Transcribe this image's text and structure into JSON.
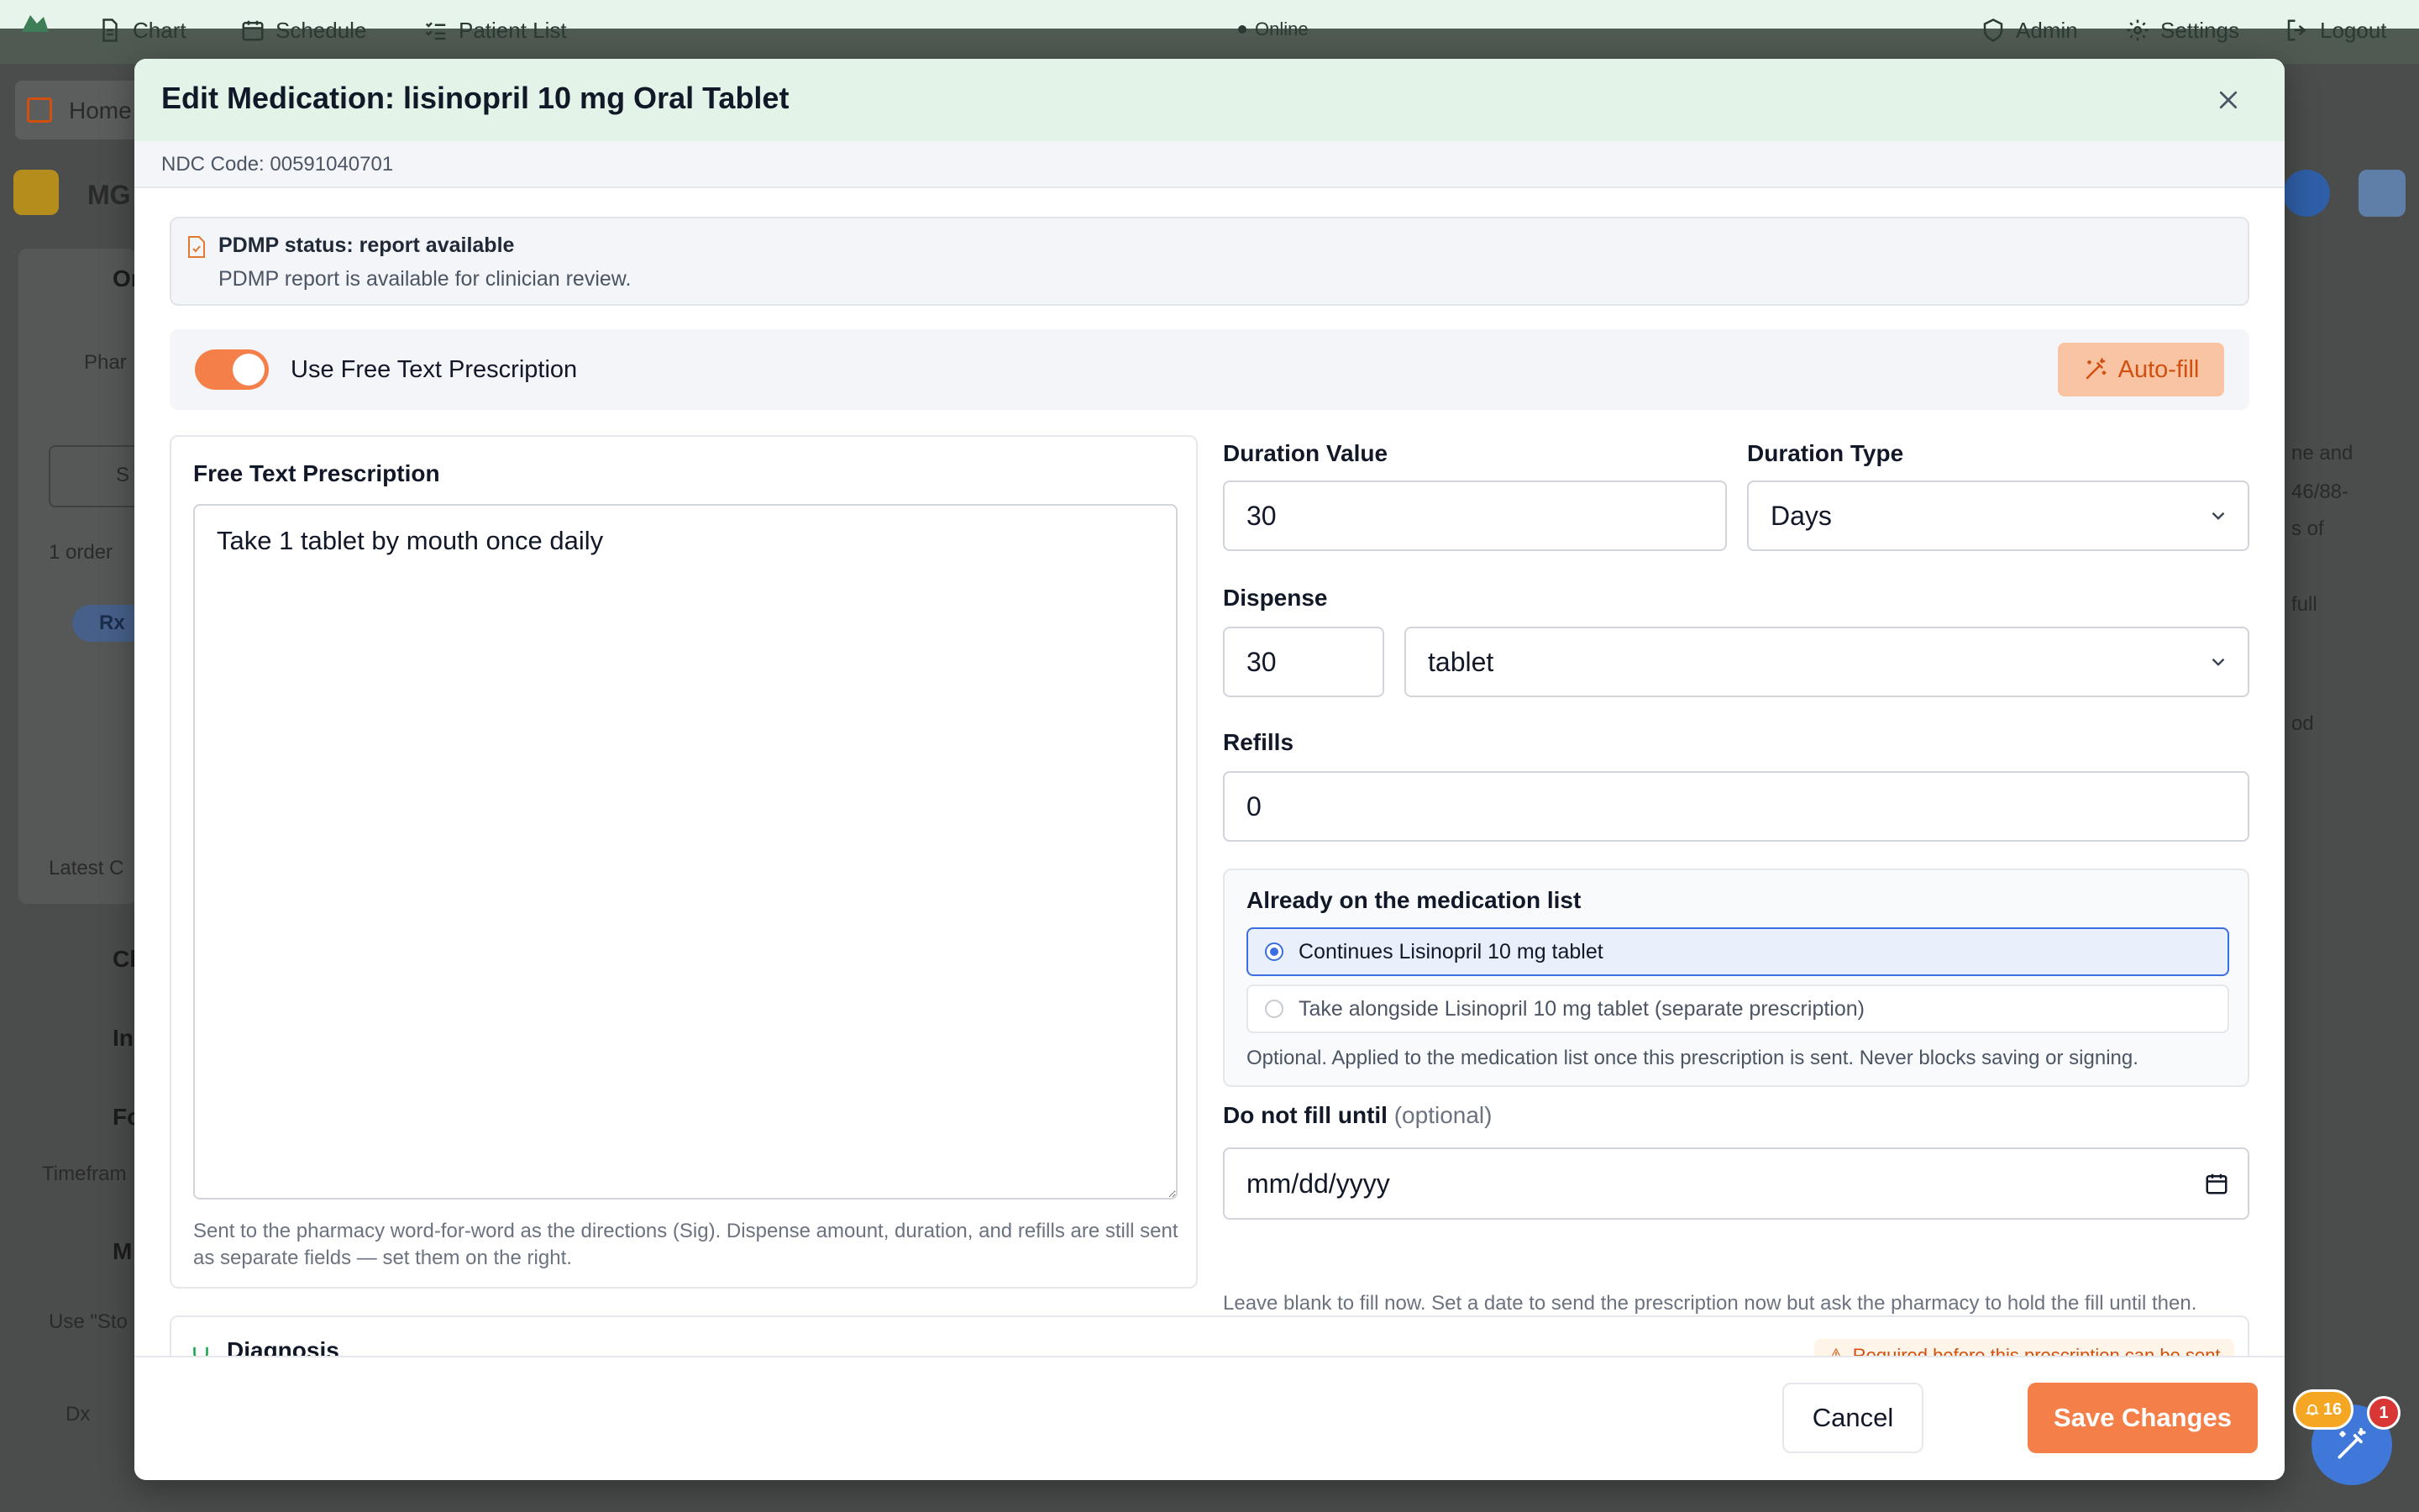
{
  "app_nav": {
    "chart": "Chart",
    "schedule": "Schedule",
    "patient_list": "Patient List",
    "status": "Online",
    "admin": "Admin",
    "settings": "Settings",
    "logout": "Logout"
  },
  "background": {
    "home": "Home",
    "patient_initials": "MG",
    "orders_section": "Or",
    "pharmacy": "Phar",
    "search_placeholder": "S",
    "order_count": "1 order",
    "rx_badge": "Rx",
    "latest": "Latest C",
    "section_cl": "Cl",
    "section_in": "In",
    "section_fo": "Fo",
    "timeframe": "Timefram",
    "section_m": "M",
    "use_store": "Use \"Sto",
    "dx_label": "Dx",
    "right_fragments": [
      "ne and",
      "46/88-",
      "s of",
      "full",
      "od"
    ]
  },
  "modal": {
    "title": "Edit Medication: lisinopril 10 mg Oral Tablet",
    "ndc": "NDC Code: 00591040701",
    "pdmp_title": "PDMP status: report available",
    "pdmp_text": "PDMP report is available for clinician review.",
    "free_text_toggle_label": "Use Free Text Prescription",
    "free_text_enabled": true,
    "autofill_label": "Auto-fill",
    "free_text_label": "Free Text Prescription",
    "free_text_value": "Take 1 tablet by mouth once daily",
    "free_text_note": "Sent to the pharmacy word-for-word as the directions (Sig). Dispense amount, duration, and refills are still sent as separate fields — set them on the right.",
    "duration_value_label": "Duration Value",
    "duration_value": "30",
    "duration_type_label": "Duration Type",
    "duration_type": "Days",
    "dispense_label": "Dispense",
    "dispense_qty": "30",
    "dispense_unit": "tablet",
    "refills_label": "Refills",
    "refills": "0",
    "med_list_title": "Already on the medication list",
    "med_option_1": "Continues Lisinopril 10 mg tablet",
    "med_option_2": "Take alongside Lisinopril 10 mg tablet (separate prescription)",
    "med_list_note": "Optional. Applied to the medication list once this prescription is sent. Never blocks saving or signing.",
    "dnf_label": "Do not fill until",
    "dnf_optional": "(optional)",
    "dnf_placeholder": "mm/dd/yyyy",
    "dnf_note": "Leave blank to fill now. Set a date to send the prescription now but ask the pharmacy to hold the fill until then.",
    "diagnosis_label": "Diagnosis",
    "diagnosis_warning": "Required before this prescription can be sent",
    "cancel_label": "Cancel",
    "save_label": "Save Changes"
  },
  "badges": {
    "notifications": "16",
    "alerts": "1"
  },
  "colors": {
    "accent": "#f47f48",
    "header_bg": "#e4f3e8",
    "selected_blue": "#3b6fe0",
    "fab_blue": "#3f78d9"
  }
}
